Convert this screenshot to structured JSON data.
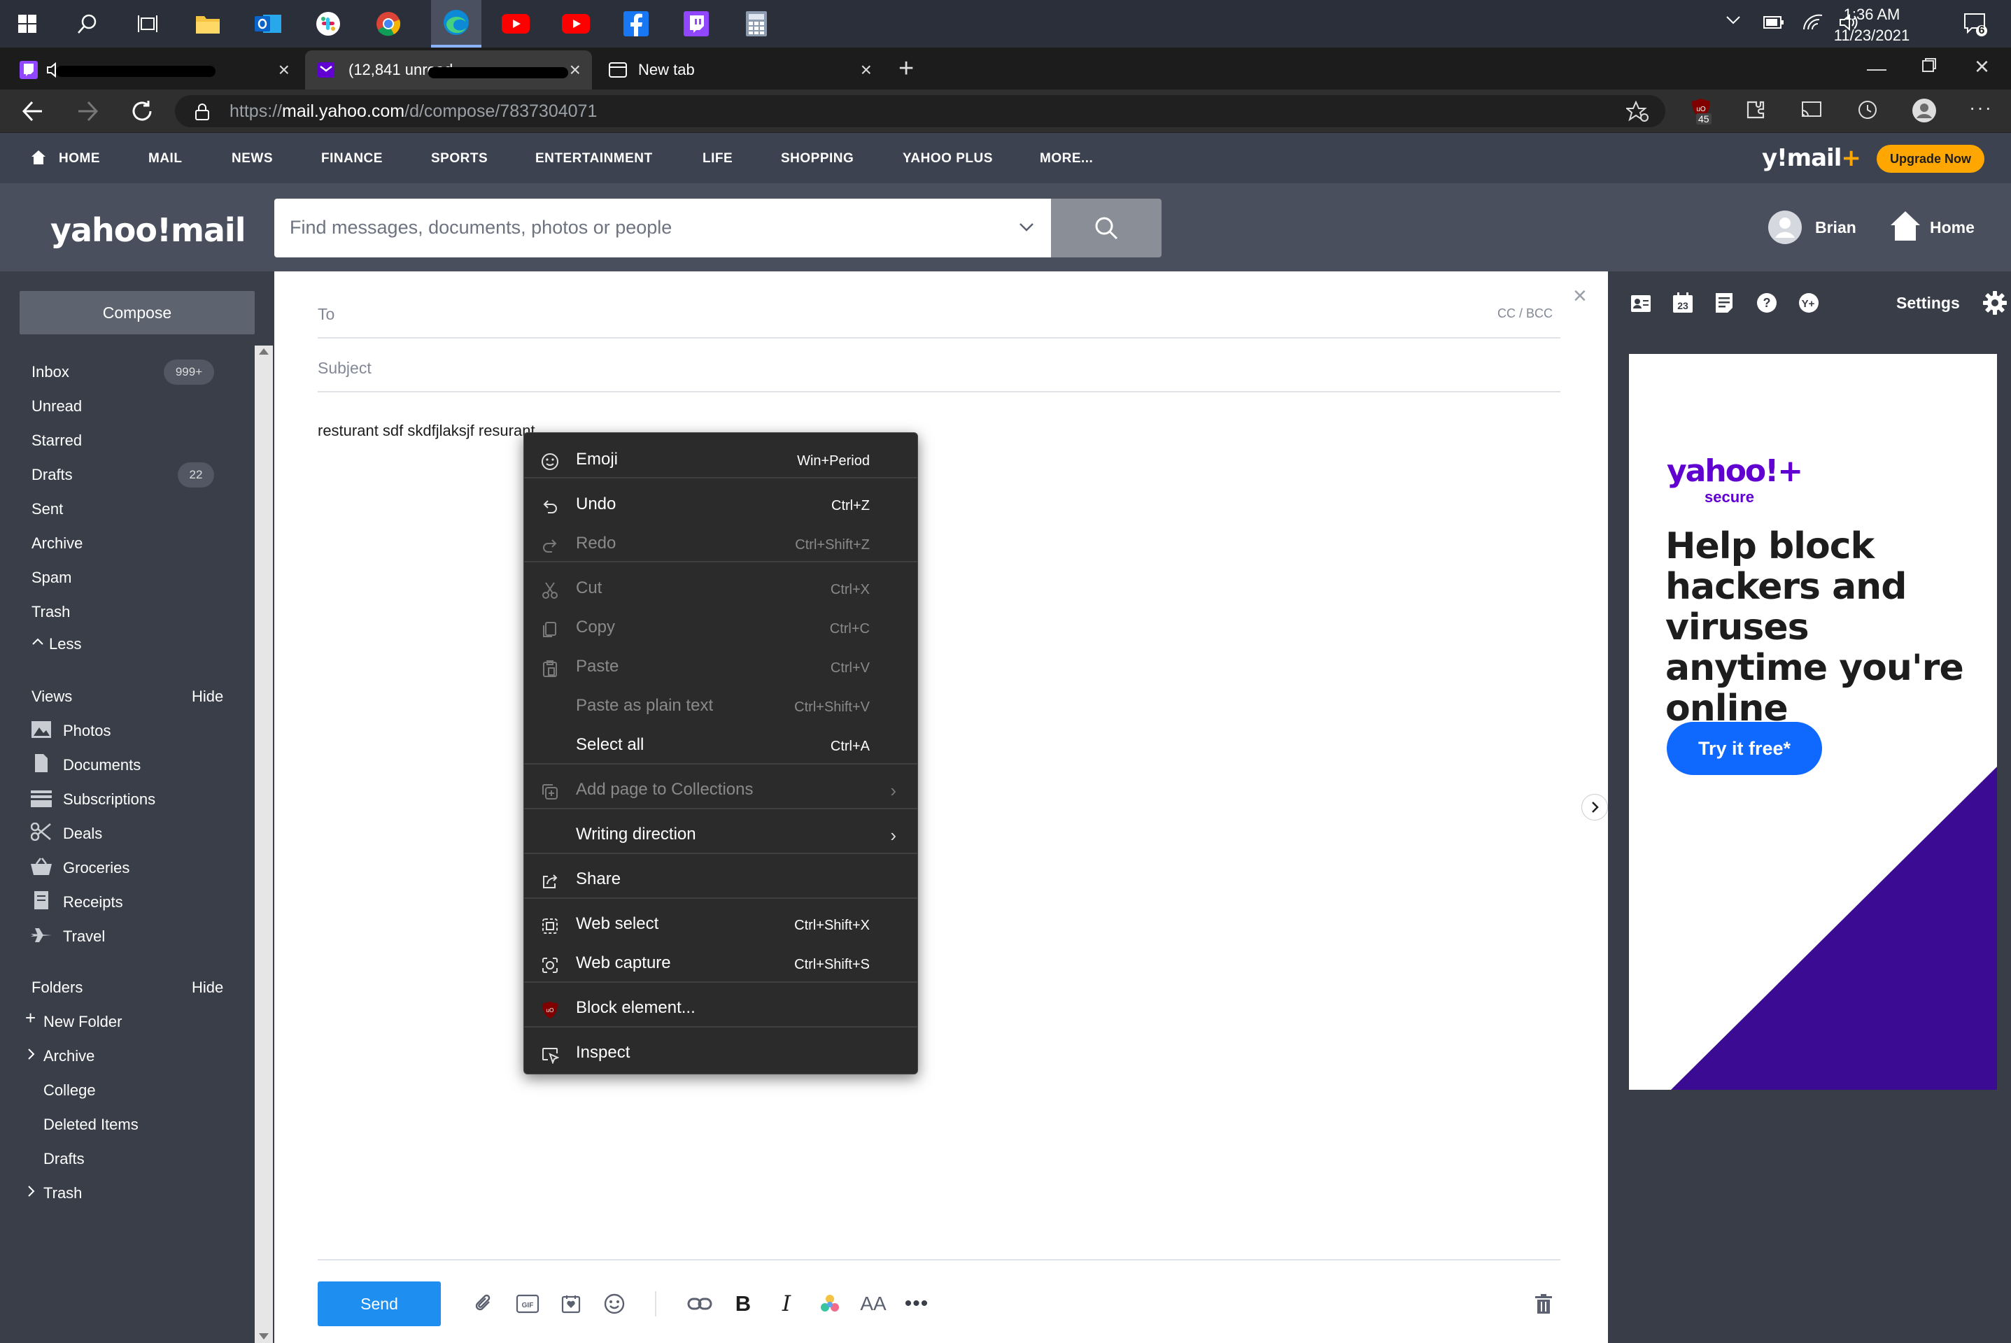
{
  "taskbar": {
    "time": "1:36 AM",
    "date": "11/23/2021",
    "notifications": "6"
  },
  "browser": {
    "tabs": [
      {
        "label": ""
      },
      {
        "label": "(12,841 unread"
      },
      {
        "label": "New tab"
      }
    ],
    "url_prefix": "https://",
    "url_host": "mail.yahoo.com",
    "url_path": "/d/compose/7837304071",
    "extension_badge": "45"
  },
  "yahoo_nav": {
    "items": [
      "HOME",
      "MAIL",
      "NEWS",
      "FINANCE",
      "SPORTS",
      "ENTERTAINMENT",
      "LIFE",
      "SHOPPING",
      "YAHOO PLUS",
      "MORE..."
    ],
    "brand": "y!mail",
    "brand_plus": "+",
    "upgrade": "Upgrade Now"
  },
  "header": {
    "logo": "yahoo!mail",
    "search_placeholder": "Find messages, documents, photos or people",
    "user": "Brian",
    "home": "Home"
  },
  "sidebar": {
    "compose": "Compose",
    "mailboxes": [
      {
        "label": "Inbox",
        "badge": "999+"
      },
      {
        "label": "Unread",
        "badge": ""
      },
      {
        "label": "Starred",
        "badge": ""
      },
      {
        "label": "Drafts",
        "badge": "22"
      },
      {
        "label": "Sent",
        "badge": ""
      },
      {
        "label": "Archive",
        "badge": ""
      },
      {
        "label": "Spam",
        "badge": ""
      },
      {
        "label": "Trash",
        "badge": ""
      }
    ],
    "less": "Less",
    "views_title": "Views",
    "views_hide": "Hide",
    "views": [
      "Photos",
      "Documents",
      "Subscriptions",
      "Deals",
      "Groceries",
      "Receipts",
      "Travel"
    ],
    "folders_title": "Folders",
    "folders_hide": "Hide",
    "new_folder": "New Folder",
    "folders": [
      "Archive",
      "College",
      "Deleted Items",
      "Drafts",
      "Trash"
    ]
  },
  "compose": {
    "to_label": "To",
    "cc_bcc": "CC / BCC",
    "subject_label": "Subject",
    "body": "resturant sdf skdfjlaksjf resurant",
    "send": "Send"
  },
  "rail": {
    "settings": "Settings",
    "calendar_day": "23"
  },
  "ad": {
    "brand": "yahoo!+",
    "brand_sub": "secure",
    "headline": "Help block hackers and viruses anytime you're online",
    "cta": "Try it free*"
  },
  "context_menu": {
    "items": [
      {
        "label": "Emoji",
        "shortcut": "Win+Period",
        "disabled": false
      },
      {
        "label": "Undo",
        "shortcut": "Ctrl+Z",
        "disabled": false
      },
      {
        "label": "Redo",
        "shortcut": "Ctrl+Shift+Z",
        "disabled": true
      },
      {
        "label": "Cut",
        "shortcut": "Ctrl+X",
        "disabled": true
      },
      {
        "label": "Copy",
        "shortcut": "Ctrl+C",
        "disabled": true
      },
      {
        "label": "Paste",
        "shortcut": "Ctrl+V",
        "disabled": true
      },
      {
        "label": "Paste as plain text",
        "shortcut": "Ctrl+Shift+V",
        "disabled": true
      },
      {
        "label": "Select all",
        "shortcut": "Ctrl+A",
        "disabled": false
      },
      {
        "label": "Add page to Collections",
        "shortcut": "",
        "disabled": true
      },
      {
        "label": "Writing direction",
        "shortcut": "",
        "disabled": false
      },
      {
        "label": "Share",
        "shortcut": "",
        "disabled": false
      },
      {
        "label": "Web select",
        "shortcut": "Ctrl+Shift+X",
        "disabled": false
      },
      {
        "label": "Web capture",
        "shortcut": "Ctrl+Shift+S",
        "disabled": false
      },
      {
        "label": "Block element...",
        "shortcut": "",
        "disabled": false
      },
      {
        "label": "Inspect",
        "shortcut": "",
        "disabled": false
      }
    ]
  },
  "colors": {
    "accent": "#1f8ef1",
    "upgrade": "#ffa700",
    "ad_purple": "#3b0b94",
    "ad_cta": "#0f69ff"
  }
}
